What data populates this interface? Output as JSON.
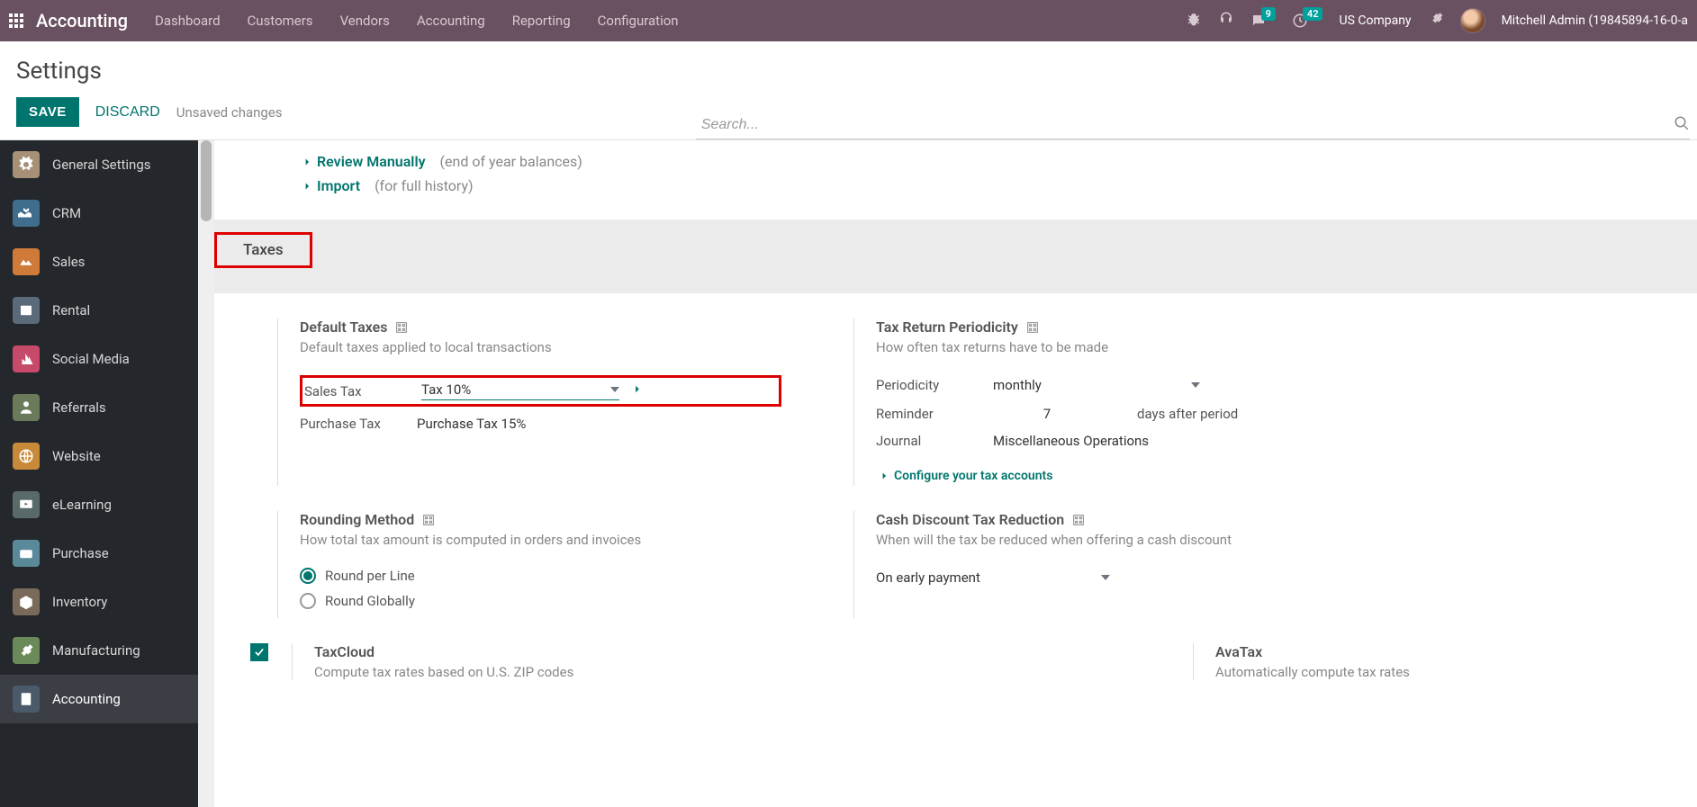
{
  "top": {
    "brand": "Accounting",
    "nav": [
      "Dashboard",
      "Customers",
      "Vendors",
      "Accounting",
      "Reporting",
      "Configuration"
    ],
    "msg_count": "9",
    "clock_count": "42",
    "company": "US Company",
    "user": "Mitchell Admin (19845894-16-0-a"
  },
  "page": {
    "title": "Settings",
    "search_placeholder": "Search...",
    "save": "SAVE",
    "discard": "DISCARD",
    "unsaved": "Unsaved changes"
  },
  "sidebar": [
    {
      "label": "General Settings",
      "color": "#a69076"
    },
    {
      "label": "CRM",
      "color": "#3f6d8e"
    },
    {
      "label": "Sales",
      "color": "#d07a3a"
    },
    {
      "label": "Rental",
      "color": "#5a6a7a"
    },
    {
      "label": "Social Media",
      "color": "#c84a6a"
    },
    {
      "label": "Referrals",
      "color": "#6a7a5a"
    },
    {
      "label": "Website",
      "color": "#c88a3a"
    },
    {
      "label": "eLearning",
      "color": "#5a6a6a"
    },
    {
      "label": "Purchase",
      "color": "#5a8a9a"
    },
    {
      "label": "Inventory",
      "color": "#7a6a5a"
    },
    {
      "label": "Manufacturing",
      "color": "#6a8a5a"
    },
    {
      "label": "Accounting",
      "color": "#4a5a6a",
      "active": true
    }
  ],
  "links": {
    "review": "Review Manually",
    "review_hint": "(end of year balances)",
    "import": "Import",
    "import_hint": "(for full history)",
    "configure_tax": "Configure your tax accounts"
  },
  "taxes": {
    "header": "Taxes",
    "default": {
      "title": "Default Taxes",
      "desc": "Default taxes applied to local transactions",
      "sales_label": "Sales Tax",
      "sales_value": "Tax 10%",
      "purchase_label": "Purchase Tax",
      "purchase_value": "Purchase Tax 15%"
    },
    "periodicity": {
      "title": "Tax Return Periodicity",
      "desc": "How often tax returns have to be made",
      "period_label": "Periodicity",
      "period_value": "monthly",
      "reminder_label": "Reminder",
      "reminder_value": "7",
      "reminder_after": "days after period",
      "journal_label": "Journal",
      "journal_value": "Miscellaneous Operations"
    },
    "rounding": {
      "title": "Rounding Method",
      "desc": "How total tax amount is computed in orders and invoices",
      "opt1": "Round per Line",
      "opt2": "Round Globally"
    },
    "cash": {
      "title": "Cash Discount Tax Reduction",
      "desc": "When will the tax be reduced when offering a cash discount",
      "value": "On early payment"
    },
    "taxcloud": {
      "title": "TaxCloud",
      "desc": "Compute tax rates based on U.S. ZIP codes"
    },
    "avatax": {
      "title": "AvaTax",
      "desc": "Automatically compute tax rates"
    }
  }
}
